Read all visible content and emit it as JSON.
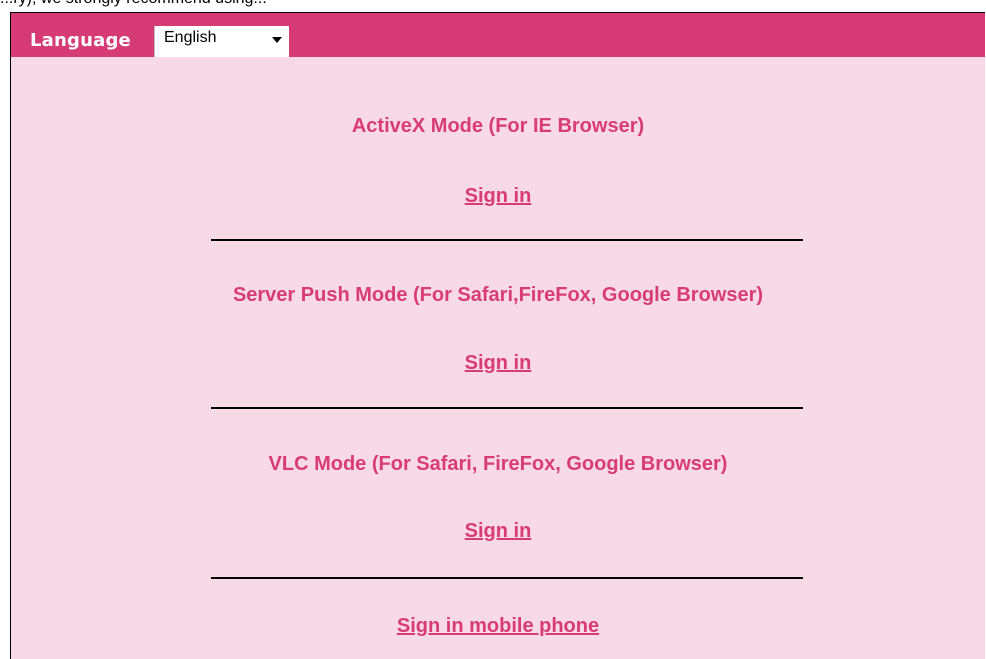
{
  "top_strip": {
    "text": "...ry), we strongly recommend using..."
  },
  "header": {
    "language_label": "Language",
    "language_selected": "English"
  },
  "modes": [
    {
      "title": "ActiveX Mode (For IE Browser)",
      "signin_label": "Sign in"
    },
    {
      "title": "Server Push Mode (For Safari,FireFox, Google Browser)",
      "signin_label": "Sign in"
    },
    {
      "title": "VLC Mode (For Safari, FireFox, Google Browser)",
      "signin_label": "Sign in"
    }
  ],
  "mobile": {
    "signin_label": "Sign in mobile phone"
  },
  "colors": {
    "header_bar": "#d63b75",
    "background": "#f7dae5",
    "accent_text": "#d83c73"
  }
}
